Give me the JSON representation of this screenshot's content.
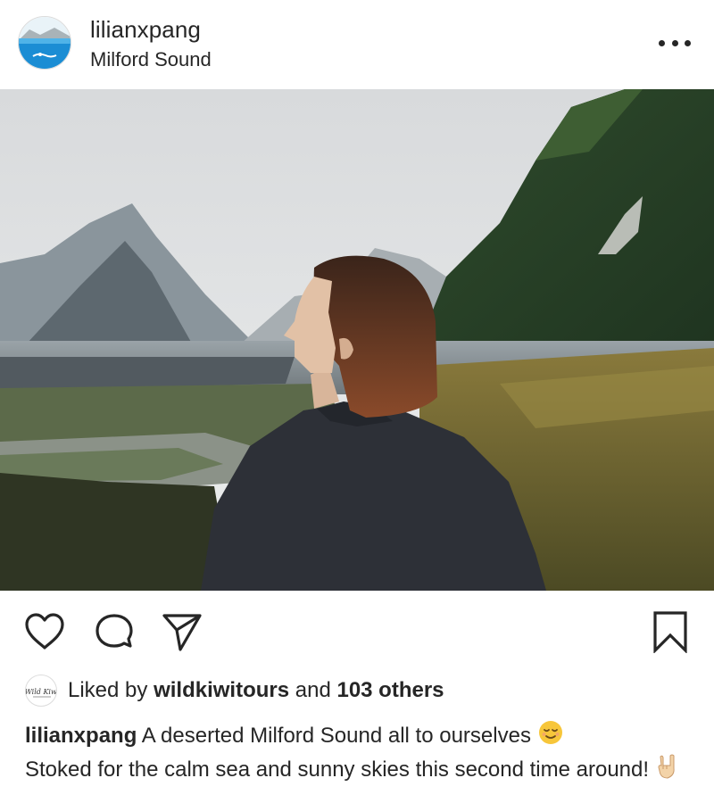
{
  "post": {
    "author": {
      "username": "lilianxpang",
      "location": "Milford Sound"
    },
    "photo": {
      "alt": "Woman looking at mountains across the water at Milford Sound"
    },
    "actions": {
      "like_icon": "heart-icon",
      "comment_icon": "comment-icon",
      "share_icon": "paper-plane-icon",
      "save_icon": "bookmark-icon"
    },
    "likes": {
      "prefix": "Liked by",
      "liker": "wildkiwitours",
      "connector": "and",
      "others": "103 others",
      "liker_avatar_text": "Wild Kiwi"
    },
    "caption": {
      "username": "lilianxpang",
      "text": "A deserted Milford Sound all to ourselves",
      "emoji1": "relieved-face-emoji",
      "text2": "Stoked for the calm sea and sunny skies this second time around!",
      "emoji2": "rock-on-hand-emoji"
    },
    "colors": {
      "text": "#262626",
      "avatar_sea": "#1a8fd6"
    }
  }
}
